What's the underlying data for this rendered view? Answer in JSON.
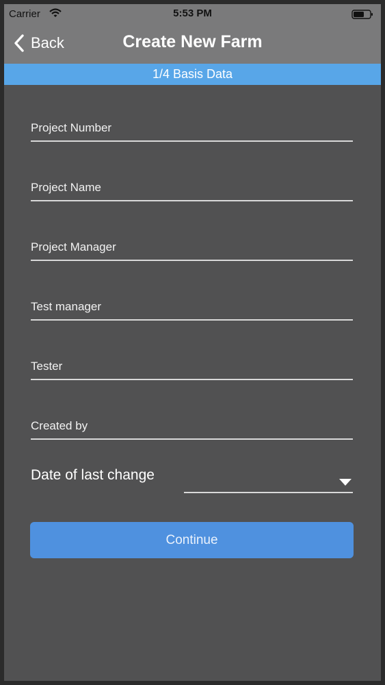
{
  "status_bar": {
    "carrier": "Carrier",
    "time": "5:53 PM",
    "icons": [
      "wifi-icon",
      "battery-icon"
    ]
  },
  "nav": {
    "back_label": "Back",
    "title": "Create New Farm",
    "back_icon": "chevron-left-icon"
  },
  "step": {
    "label": "1/4 Basis Data"
  },
  "form": {
    "fields": [
      {
        "placeholder": "Project Number",
        "value": ""
      },
      {
        "placeholder": "Project Name",
        "value": ""
      },
      {
        "placeholder": "Project Manager",
        "value": ""
      },
      {
        "placeholder": "Test manager",
        "value": ""
      },
      {
        "placeholder": "Tester",
        "value": ""
      },
      {
        "placeholder": "Created by",
        "value": ""
      }
    ],
    "date_of_last_change": {
      "label": "Date of last change",
      "value": "",
      "icon": "dropdown-arrow-icon"
    },
    "continue_label": "Continue"
  },
  "colors": {
    "nav_background": "#7a7a7b",
    "step_bar": "#58a6e8",
    "screen_background": "#515152",
    "button": "#4f91df"
  }
}
